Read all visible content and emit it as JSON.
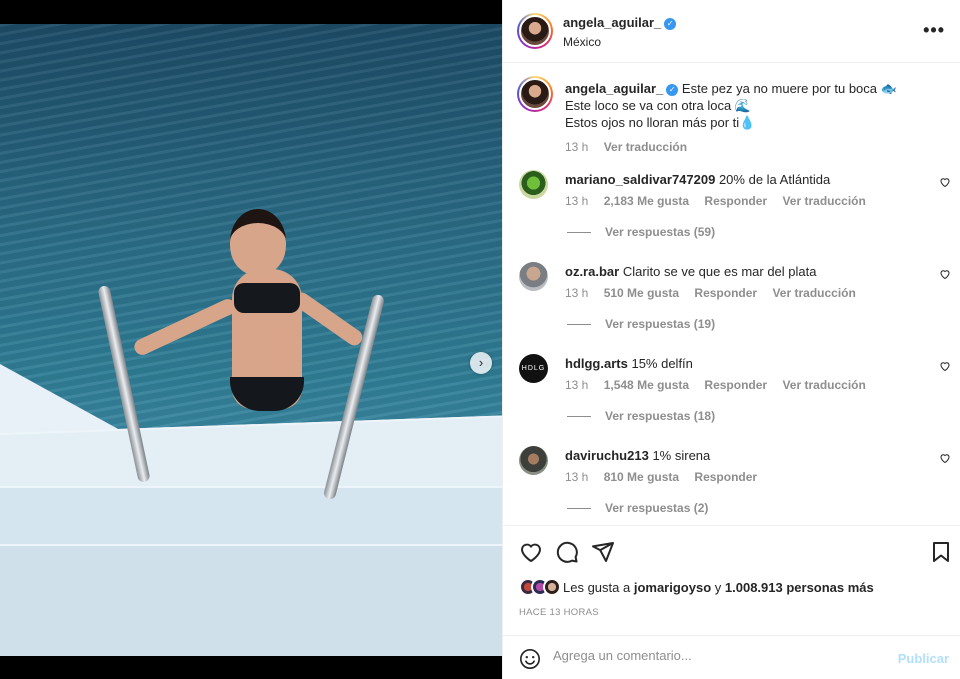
{
  "media": {
    "next_glyph": "›",
    "carousel_count": 4,
    "carousel_active": 1
  },
  "header": {
    "username": "angela_aguilar_",
    "location": "México",
    "more_glyph": "•••"
  },
  "caption": {
    "username": "angela_aguilar_",
    "line1": "Este pez ya no muere por tu boca 🐟",
    "line2": "Este loco se va con otra loca 🌊",
    "line3": "Estos ojos no lloran más por ti💧",
    "time": "13 h",
    "translate": "Ver traducción"
  },
  "labels": {
    "reply": "Responder",
    "translate": "Ver traducción"
  },
  "comments": [
    {
      "user": "mariano_saldivar747209",
      "text": "20% de la Atlántida",
      "time": "13 h",
      "likes": "2,183 Me gusta",
      "replies": "Ver respuestas (59)"
    },
    {
      "user": "oz.ra.bar",
      "text": "Clarito se ve que es mar del plata",
      "time": "13 h",
      "likes": "510 Me gusta",
      "replies": "Ver respuestas (19)"
    },
    {
      "user": "hdlgg.arts",
      "text": "15% delfín",
      "time": "13 h",
      "likes": "1,548 Me gusta",
      "replies": "Ver respuestas (18)",
      "avatar_text": "HDLG"
    },
    {
      "user": "daviruchu213",
      "text": "1% sirena",
      "time": "13 h",
      "likes": "810 Me gusta",
      "replies": "Ver respuestas (2)"
    }
  ],
  "likes": {
    "prefix": "Les gusta a",
    "user": "jomarigoyso",
    "and": "y",
    "others": "1.008.913 personas más"
  },
  "post_time": "HACE 13 HORAS",
  "composer": {
    "placeholder": "Agrega un comentario...",
    "submit": "Publicar"
  },
  "colors": {
    "accent": "#3897f0",
    "publish_disabled": "#b2dffc",
    "muted_text": "#8e8e8e"
  }
}
